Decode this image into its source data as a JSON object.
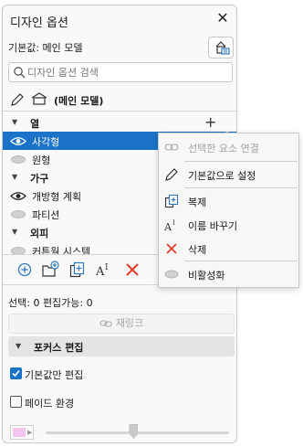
{
  "panel": {
    "title": "디자인 옵션",
    "close_icon": "close-icon",
    "default_label": "기본값: 메인 모델",
    "search_placeholder": "디자인 옵션 검색",
    "edit_label": "(메인 모델)"
  },
  "groups": [
    {
      "name": "열",
      "items": [
        {
          "label": "사각형",
          "visible": true,
          "selected": true
        },
        {
          "label": "원형",
          "visible": false,
          "selected": false
        }
      ]
    },
    {
      "name": "가구",
      "items": [
        {
          "label": "개방형 계획",
          "visible": true,
          "selected": false
        },
        {
          "label": "파티션",
          "visible": false,
          "selected": false
        }
      ]
    },
    {
      "name": "외피",
      "items": [
        {
          "label": "커튼월 시스템",
          "visible": false,
          "selected": false
        }
      ]
    }
  ],
  "toolbar": {
    "buttons": [
      "add-option-icon",
      "new-folder-icon",
      "duplicate-icon",
      "rename-icon",
      "delete-icon"
    ]
  },
  "status": "선택: 0 편집가능: 0",
  "relink_label": "재링크",
  "focus_section": {
    "title": "포커스 편집",
    "default_only": {
      "label": "기본값만 편집",
      "checked": true
    },
    "fade": {
      "label": "페이드 환경",
      "checked": false
    },
    "fade_color": "#f5c6f0",
    "fade_level": 0.48
  },
  "context_menu": {
    "items": [
      {
        "label": "선택한 요소 연결",
        "icon": "link-icon",
        "disabled": true
      },
      {
        "label": "기본값으로 설정",
        "icon": "pencil-icon",
        "disabled": false
      },
      {
        "label": "복제",
        "icon": "duplicate-icon",
        "disabled": false
      },
      {
        "label": "이름 바꾸기",
        "icon": "rename-icon",
        "disabled": false
      },
      {
        "label": "삭제",
        "icon": "delete-icon",
        "disabled": false
      },
      {
        "label": "비활성화",
        "icon": "disable-icon",
        "disabled": false
      }
    ]
  },
  "colors": {
    "accent": "#1a73c8",
    "delete": "#e03c2b",
    "icon_blue": "#2f78c4"
  }
}
